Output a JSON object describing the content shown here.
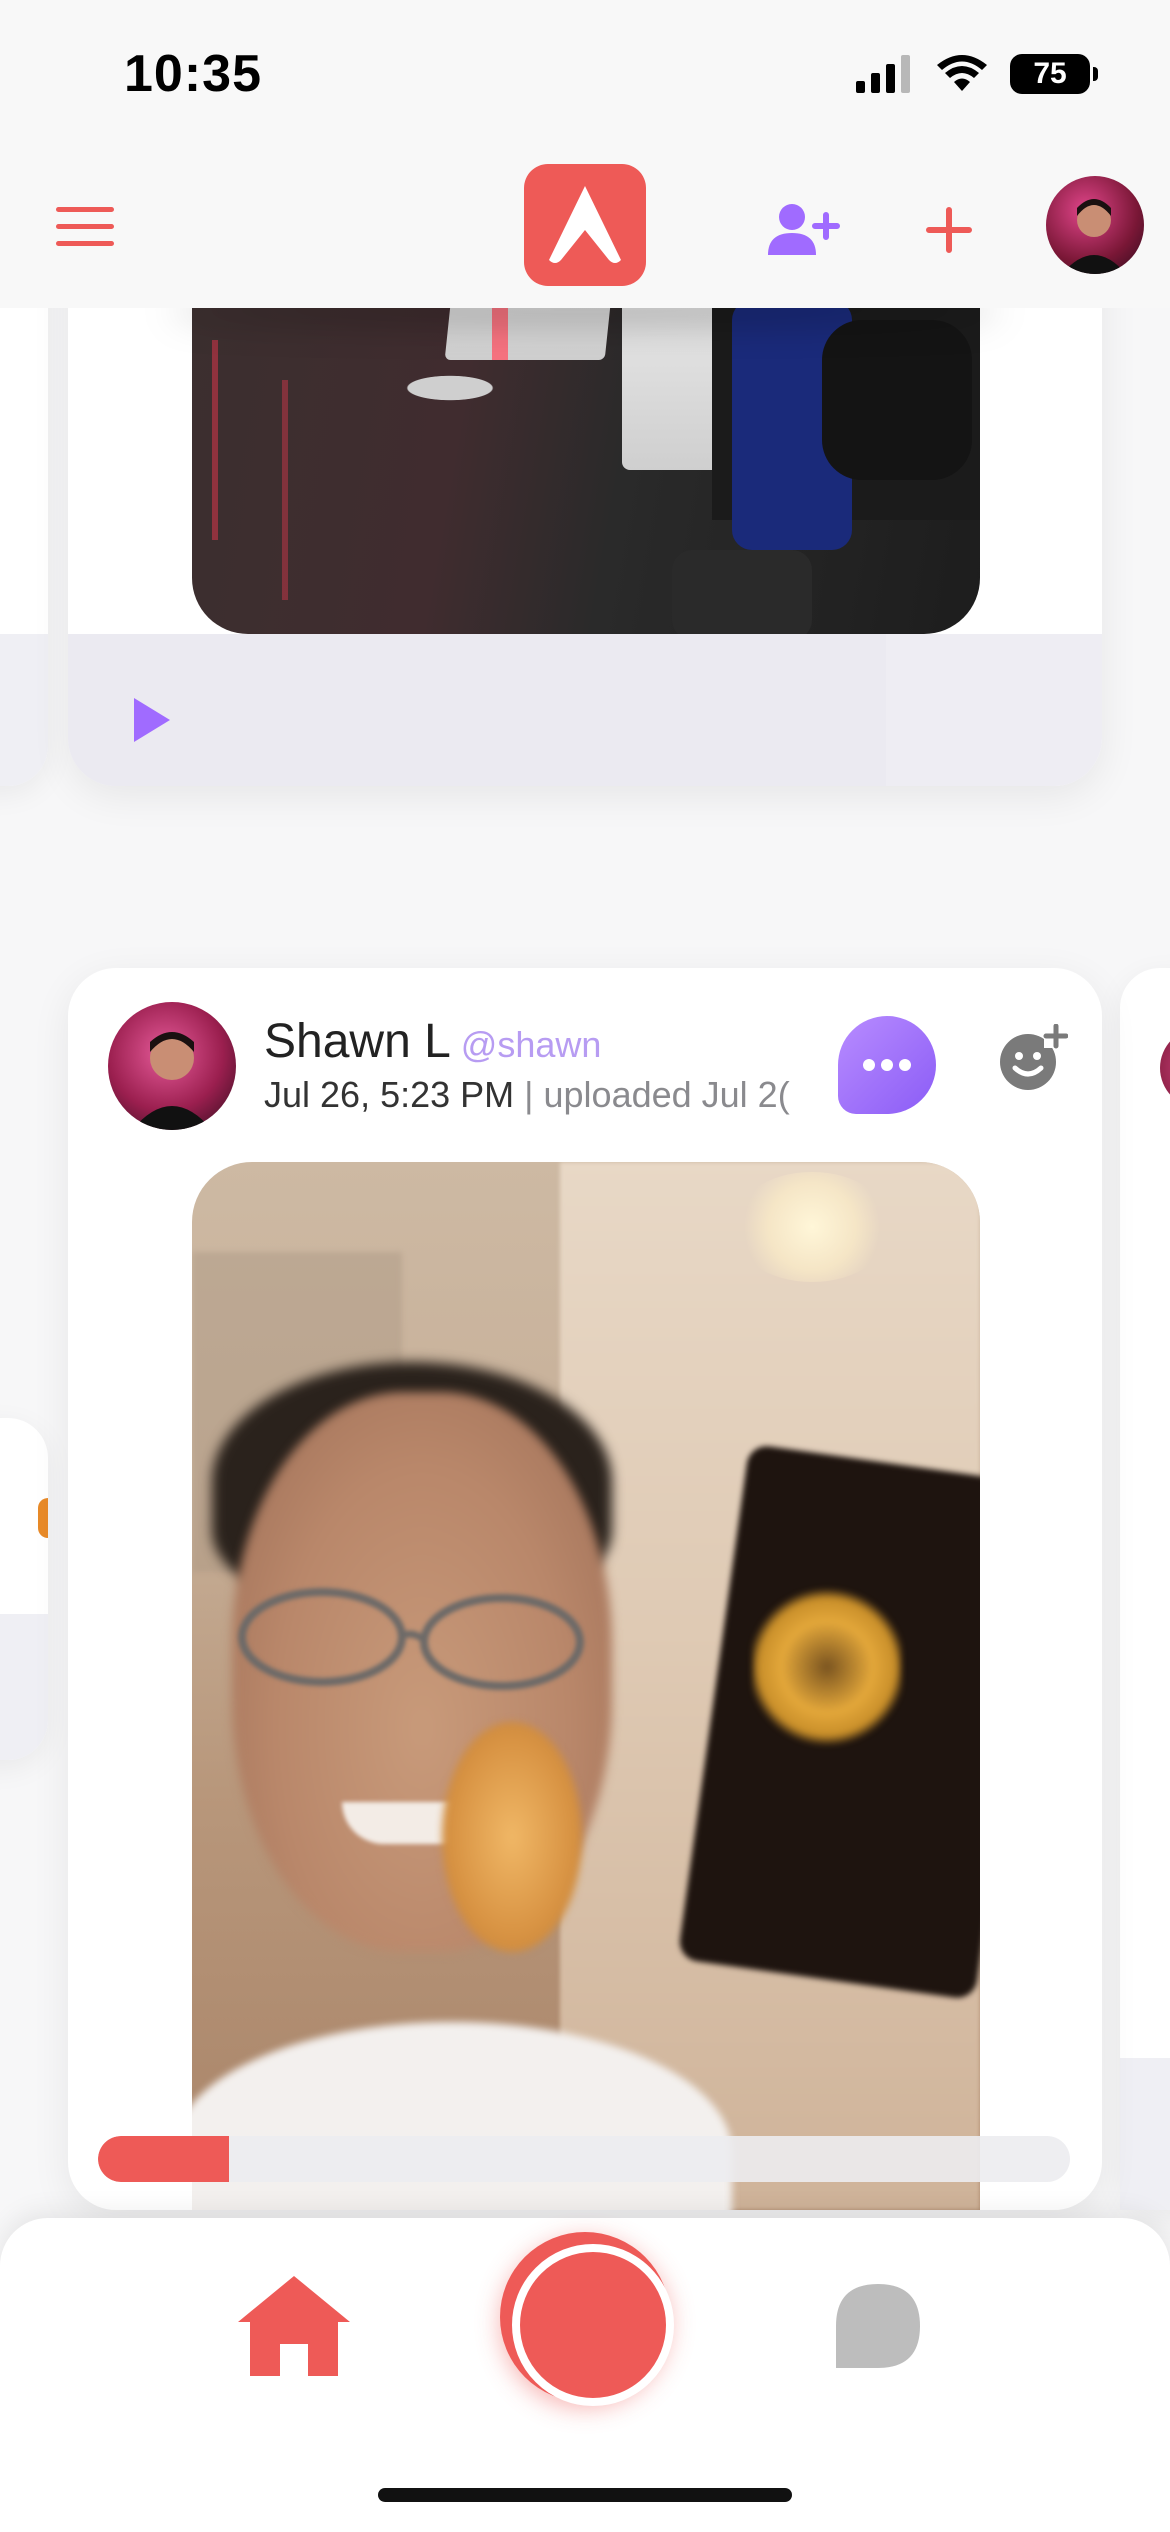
{
  "status_bar": {
    "time": "10:35",
    "battery": "75",
    "icons": [
      "cellular-signal-icon",
      "wifi-icon",
      "battery-icon"
    ]
  },
  "top_nav": {
    "icons": [
      "hamburger-menu-icon",
      "app-logo-icon",
      "add-friend-icon",
      "plus-icon",
      "profile-avatar"
    ]
  },
  "colors": {
    "accent_red": "#ee5a57",
    "accent_purple": "#a06bff",
    "handle_purple": "#b79cf2",
    "muted_gray": "#8a8a8e"
  },
  "feed": {
    "previous_post": {
      "play_icon": "play-icon"
    },
    "post": {
      "author_name": "Shawn L",
      "author_handle": "@shawn",
      "timestamp": "Jul 26, 5:23 PM",
      "uploaded": "| uploaded Jul 2(",
      "playback_progress": 0.135,
      "icons": [
        "more-options-icon",
        "add-reaction-icon"
      ]
    }
  },
  "tab_bar": {
    "icons": [
      "home-icon",
      "record-icon",
      "chat-icon"
    ]
  }
}
